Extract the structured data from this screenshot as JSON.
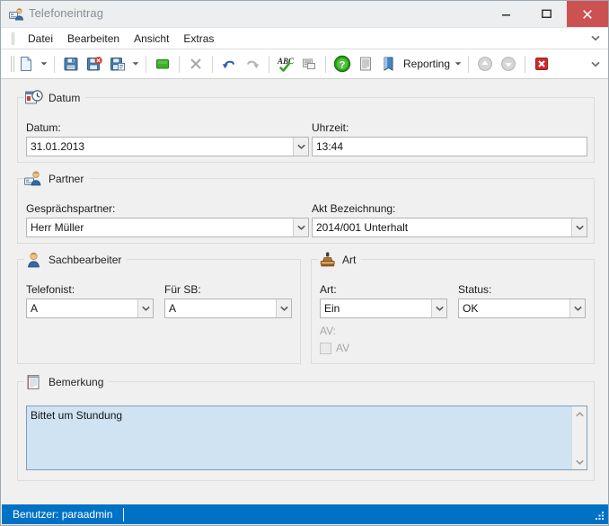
{
  "window": {
    "title": "Telefoneintrag",
    "icon": "phone-user-icon",
    "minimize_label": "–",
    "maximize_label": "□",
    "close_label": "✕"
  },
  "menubar": {
    "items": [
      {
        "label": "Datei",
        "name": "menu-datei"
      },
      {
        "label": "Bearbeiten",
        "name": "menu-bearbeiten"
      },
      {
        "label": "Ansicht",
        "name": "menu-ansicht"
      },
      {
        "label": "Extras",
        "name": "menu-extras"
      }
    ],
    "overflow": "∨"
  },
  "toolbar": {
    "reporting_label": "Reporting",
    "overflow": "∨",
    "buttons": [
      {
        "name": "new-document-button",
        "icon": "new-document-icon"
      },
      {
        "name": "new-document-dropdown",
        "icon": "chevron-down-icon"
      },
      {
        "name": "save-button",
        "icon": "floppy-save-icon"
      },
      {
        "name": "save-close-button",
        "icon": "floppy-delete-icon"
      },
      {
        "name": "save-as-button",
        "icon": "floppy-copy-icon"
      },
      {
        "name": "save-as-dropdown",
        "icon": "chevron-down-icon"
      },
      {
        "name": "stop-button",
        "icon": "green-square-icon"
      },
      {
        "name": "delete-button",
        "icon": "x-cross-icon"
      },
      {
        "name": "undo-button",
        "icon": "undo-arrow-icon"
      },
      {
        "name": "redo-button",
        "icon": "redo-arrow-icon"
      },
      {
        "name": "spellcheck-button",
        "icon": "abc-check-icon"
      },
      {
        "name": "notes-button",
        "icon": "note-stack-icon"
      },
      {
        "name": "help-button",
        "icon": "green-question-icon"
      },
      {
        "name": "document-button",
        "icon": "text-document-icon"
      },
      {
        "name": "reporting-button",
        "icon": "blue-book-icon"
      },
      {
        "name": "reporting-dropdown",
        "icon": "chevron-down-icon"
      },
      {
        "name": "previous-record-button",
        "icon": "up-arrow-circle-icon"
      },
      {
        "name": "next-record-button",
        "icon": "down-arrow-circle-icon"
      },
      {
        "name": "close-record-button",
        "icon": "red-x-icon"
      }
    ]
  },
  "form": {
    "datum_group": {
      "legend": "Datum",
      "icon": "calendar-clock-icon",
      "datum_label": "Datum:",
      "datum_value": "31.01.2013",
      "uhrzeit_label": "Uhrzeit:",
      "uhrzeit_value": "13:44"
    },
    "partner_group": {
      "legend": "Partner",
      "icon": "partner-person-icon",
      "gespraechspartner_label": "Gesprächspartner:",
      "gespraechspartner_value": "Herr Müller",
      "akt_label": "Akt Bezeichnung:",
      "akt_value": "2014/001 Unterhalt"
    },
    "sachbearbeiter_group": {
      "legend": "Sachbearbeiter",
      "icon": "person-icon",
      "telefonist_label": "Telefonist:",
      "telefonist_value": "A",
      "fuer_sb_label": "Für SB:",
      "fuer_sb_value": "A"
    },
    "art_group": {
      "legend": "Art",
      "icon": "rubber-stamp-icon",
      "art_label": "Art:",
      "art_value": "Ein",
      "status_label": "Status:",
      "status_value": "OK",
      "av_label": "AV:",
      "av_checkbox_label": "AV",
      "av_checked": false
    },
    "bemerkung_group": {
      "legend": "Bemerkung",
      "icon": "notepad-icon",
      "text": "Bittet um Stundung"
    }
  },
  "statusbar": {
    "user_text": "Benutzer: paraadmin",
    "accent": "#0072c6"
  }
}
